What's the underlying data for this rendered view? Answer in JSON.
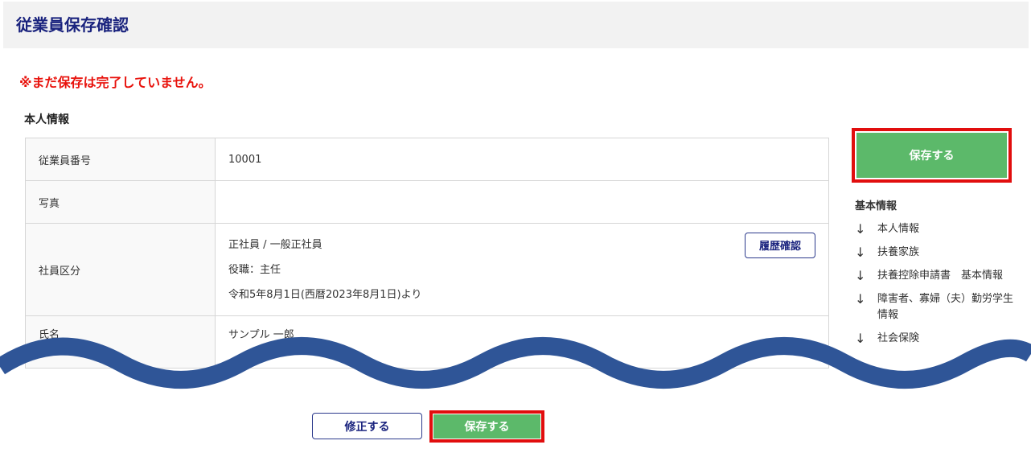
{
  "header": {
    "title": "従業員保存確認"
  },
  "warning": "※まだ保存は完了していません。",
  "section": {
    "title": "本人情報"
  },
  "table": {
    "employee_number": {
      "label": "従業員番号",
      "value": "10001"
    },
    "photo": {
      "label": "写真",
      "value": ""
    },
    "classification": {
      "label": "社員区分",
      "lines": [
        "正社員 / 一般正社員",
        "役職：主任",
        "令和5年8月1日(西暦2023年8月1日)より"
      ],
      "history_button": "履歴確認"
    },
    "name": {
      "label": "氏名",
      "value": "サンプル 一郎"
    }
  },
  "sidebar": {
    "save_button": "保存する",
    "nav_heading": "基本情報",
    "nav_items": [
      {
        "label": "本人情報",
        "icon": "arrow-down-icon"
      },
      {
        "label": "扶養家族",
        "icon": "arrow-down-icon"
      },
      {
        "label": "扶養控除申請書　基本情報",
        "icon": "arrow-down-icon"
      },
      {
        "label": "障害者、寡婦（夫）勤労学生情報",
        "icon": "arrow-down-icon"
      },
      {
        "label": "社会保険",
        "icon": "arrow-down-icon"
      }
    ]
  },
  "footer": {
    "edit_button": "修正する",
    "save_button": "保存する"
  },
  "colors": {
    "title": "#1a237e",
    "warning": "#e8120c",
    "save_green": "#5cb96a",
    "highlight_red": "#e10e0e",
    "wave": "#2f5597"
  }
}
